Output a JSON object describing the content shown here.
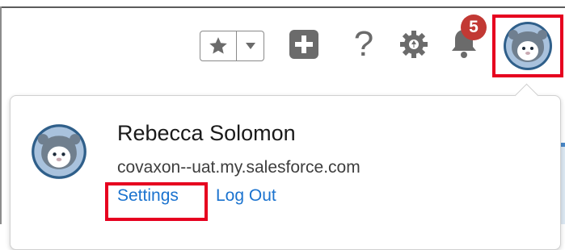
{
  "header": {
    "notifications_count": "5",
    "help_glyph": "?",
    "icons": [
      "star-icon",
      "chevron-down-icon",
      "plus-icon",
      "help-icon",
      "gear-icon",
      "bell-icon",
      "avatar"
    ]
  },
  "profile": {
    "name": "Rebecca Solomon",
    "domain": "covaxon--uat.my.salesforce.com",
    "settings_label": "Settings",
    "logout_label": "Log Out"
  },
  "colors": {
    "highlight": "#e6001f",
    "badge": "#c23934",
    "link": "#1b73cf",
    "avatar_ring": "#2f5f8a",
    "avatar_fill": "#a9c2dd"
  }
}
